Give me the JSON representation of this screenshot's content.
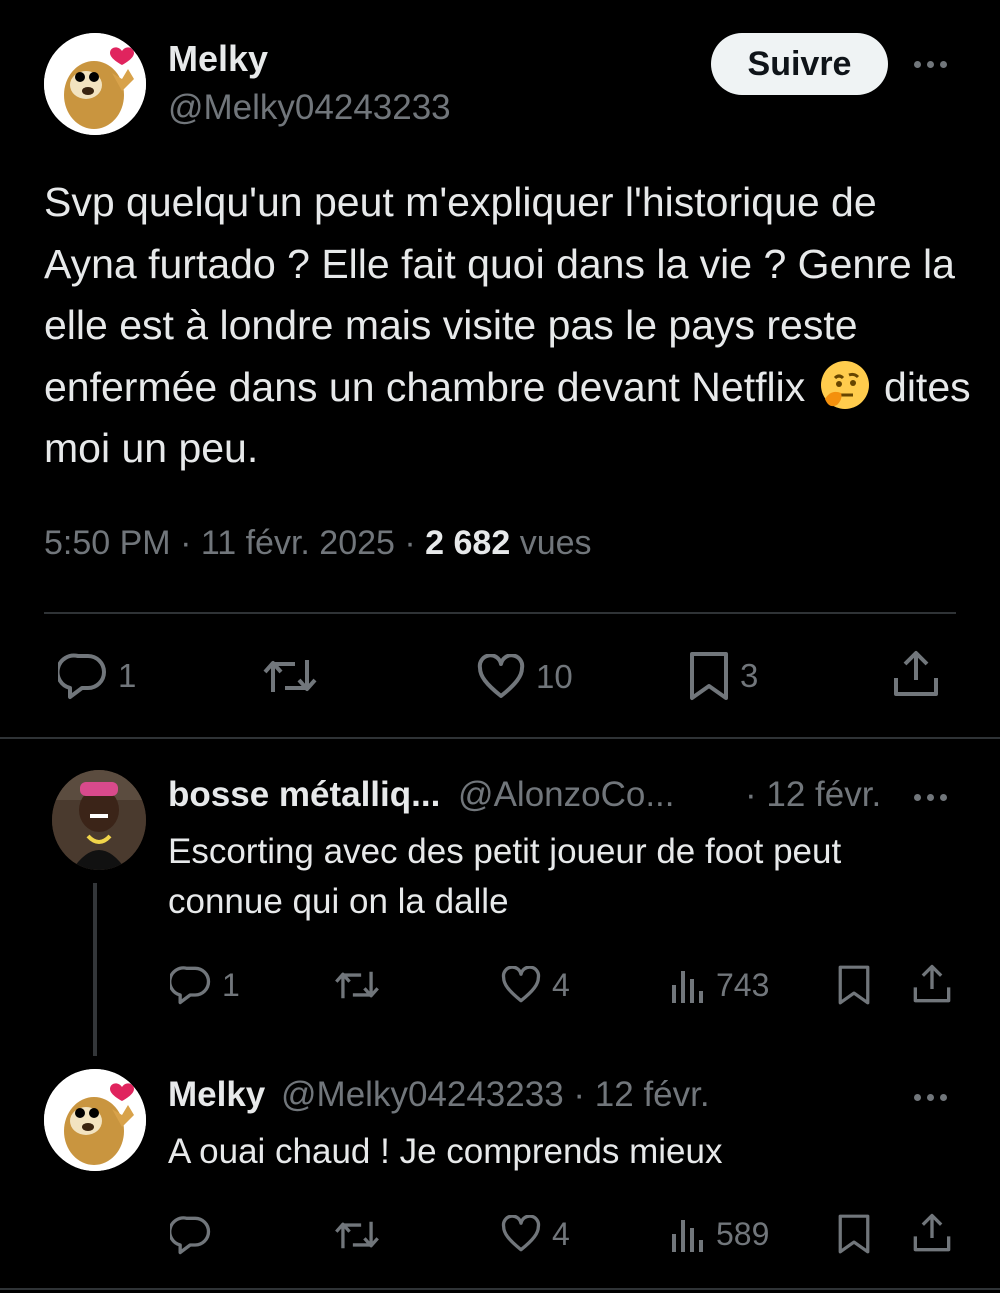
{
  "main_tweet": {
    "author_name": "Melky",
    "author_handle": "@Melky04243233",
    "follow_label": "Suivre",
    "text_before_emoji": "Svp quelqu'un peut m'expliquer l'historique de Ayna furtado ? Elle fait quoi dans la vie ? Genre la elle est à londre mais visite pas le pays reste enfermée dans un chambre devant Netflix",
    "emoji": "thinking-face-emoji",
    "text_after_emoji": "dites moi un peu.",
    "time": "5:50 PM",
    "date": "11 févr. 2025",
    "views_count": "2 682",
    "views_label": "vues",
    "replies": "1",
    "likes": "10",
    "bookmarks": "3"
  },
  "replies": [
    {
      "author_name": "bosse métalliq...",
      "author_handle": "@AlonzoCo...",
      "date": "· 12 févr.",
      "text": "Escorting avec des petit joueur de foot peut connue qui on la dalle",
      "replies": "1",
      "likes": "4",
      "views": "743"
    },
    {
      "author_name": "Melky",
      "author_handle": "@Melky04243233",
      "date": "· 12 févr.",
      "text": "A ouai chaud ! Je comprends mieux",
      "likes": "4",
      "views": "589"
    }
  ],
  "colors": {
    "background": "#000000",
    "text": "#e7e9ea",
    "muted": "#71767b",
    "divider": "#2f3336",
    "button": "#eff3f4"
  }
}
